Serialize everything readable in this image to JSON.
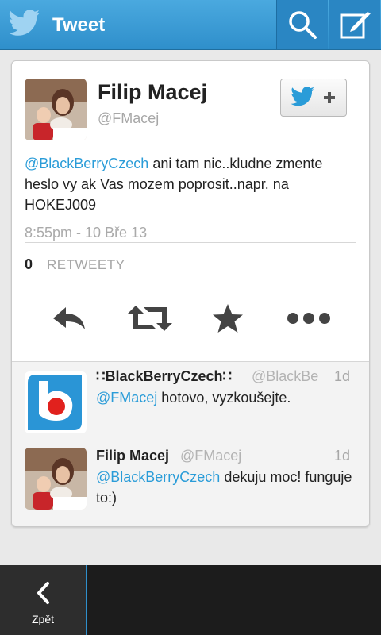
{
  "header": {
    "title": "Tweet",
    "icons": {
      "logo": "twitter-bird-icon",
      "search": "search-icon",
      "compose": "compose-icon"
    }
  },
  "tweet": {
    "name": "Filip Macej",
    "handle": "@FMacej",
    "mention": "@BlackBerryCzech",
    "text": " ani tam nic..kludne zmente heslo vy ak Vas mozem poprosit..napr. na HOKEJ009",
    "timestamp": "8:55pm - 10 Bře 13",
    "retweet_count": "0",
    "retweet_label": "RETWEETY"
  },
  "actions": [
    "reply-icon",
    "retweet-icon",
    "favorite-icon",
    "more-icon"
  ],
  "replies": [
    {
      "name": "∷BlackBerryCzech∷",
      "handle": "@BlackBe",
      "time": "1d",
      "mention": "@FMacej",
      "text": " hotovo, vyzkoušejte."
    },
    {
      "name": "Filip Macej",
      "handle": "@FMacej",
      "time": "1d",
      "mention": "@BlackBerryCzech",
      "text": " dekuju moc! funguje to:)"
    }
  ],
  "bottombar": {
    "back_label": "Zpět"
  },
  "colors": {
    "accent": "#2a9cd8",
    "header": "#3a9ad6"
  }
}
